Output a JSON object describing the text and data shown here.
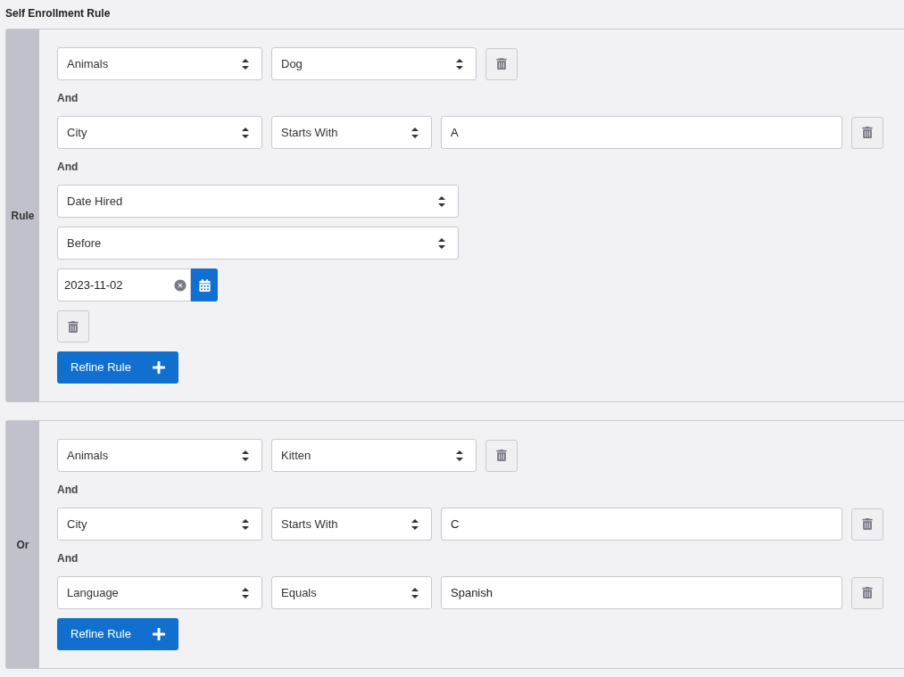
{
  "title": "Self Enrollment Rule",
  "groups": [
    {
      "label": "Rule",
      "conditions": [
        {
          "kind": "pair",
          "field": "Animals",
          "value": "Dog"
        },
        {
          "kind": "text",
          "connector": "And",
          "field": "City",
          "operator": "Starts With",
          "value": "A"
        },
        {
          "kind": "date",
          "connector": "And",
          "field": "Date Hired",
          "operator": "Before",
          "value": "2023-11-02"
        }
      ],
      "button": "Refine Rule"
    },
    {
      "label": "Or",
      "conditions": [
        {
          "kind": "pair",
          "field": "Animals",
          "value": "Kitten"
        },
        {
          "kind": "text",
          "connector": "And",
          "field": "City",
          "operator": "Starts With",
          "value": "C"
        },
        {
          "kind": "text",
          "connector": "And",
          "field": "Language",
          "operator": "Equals",
          "value": "Spanish"
        }
      ],
      "button": "Refine Rule"
    }
  ]
}
